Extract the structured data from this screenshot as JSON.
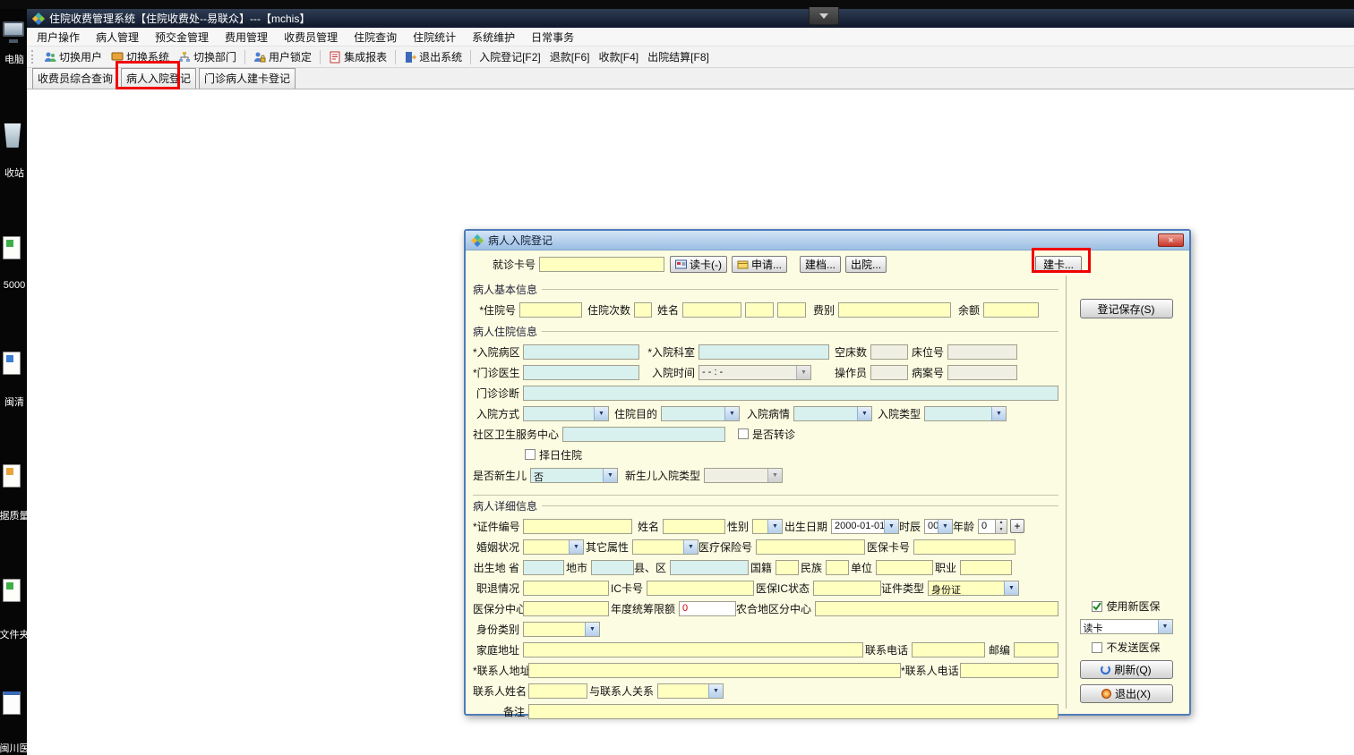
{
  "colors": {
    "annotation": "#f00000",
    "input_yellow": "#ffffc0",
    "input_cyan": "#d8f0ee",
    "dialog_bg": "#fcfce2"
  },
  "desktop": {
    "icons": [
      {
        "label": "电脑"
      },
      {
        "label": "收站"
      },
      {
        "label": "5000"
      },
      {
        "label": "闽清"
      },
      {
        "label": "据质量"
      },
      {
        "label": "文件夹"
      },
      {
        "label": "闽川医"
      }
    ]
  },
  "titlebar": {
    "title": "住院收费管理系统【住院收费处--易联众】---【mchis】"
  },
  "menubar": {
    "items": [
      "用户操作",
      "病人管理",
      "预交金管理",
      "费用管理",
      "收费员管理",
      "住院查询",
      "住院统计",
      "系统维护",
      "日常事务"
    ]
  },
  "toolbar": {
    "items": [
      "切换用户",
      "切换系统",
      "切换部门",
      "用户锁定",
      "集成报表",
      "退出系统",
      "入院登记[F2]",
      "退款[F6]",
      "收款[F4]",
      "出院结算[F8]"
    ]
  },
  "tabs": {
    "items": [
      "收费员综合查询",
      "病人入院登记",
      "门诊病人建卡登记"
    ]
  },
  "dialog": {
    "title": "病人入院登记",
    "close_glyph": "×",
    "card_row": {
      "label": "就诊卡号",
      "read_card": "读卡(-)",
      "apply": "申请...",
      "create_file": "建档...",
      "discharge": "出院...",
      "create_card": "建卡..."
    },
    "basic": {
      "legend": "病人基本信息",
      "inpatient_no": "*住院号",
      "admit_count": "住院次数",
      "name": "姓名",
      "fee_type": "费别",
      "balance": "余额"
    },
    "admission": {
      "legend": "病人住院信息",
      "ward": "*入院病区",
      "dept": "*入院科室",
      "empty_beds": "空床数",
      "bed_no": "床位号",
      "doctor": "*门诊医生",
      "admit_time": "入院时间",
      "admit_time_value": "- -   :   -",
      "operator": "操作员",
      "record_no": "病案号",
      "diagnosis": "门诊诊断",
      "admit_way": "入院方式",
      "purpose": "住院目的",
      "condition": "入院病情",
      "admit_type": "入院类型",
      "community": "社区卫生服务中心",
      "is_referral": "是否转诊",
      "scheduled": "择日住院",
      "is_newborn": "是否新生儿",
      "is_newborn_value": "否",
      "newborn_type": "新生儿入院类型"
    },
    "detail": {
      "legend": "病人详细信息",
      "cert_no": "*证件编号",
      "name": "姓名",
      "gender": "性别",
      "birth_date": "出生日期",
      "birth_date_value": "2000-01-01",
      "hour": "时辰",
      "hour_value": "00",
      "age": "年龄",
      "age_value": "0",
      "plus": "+",
      "marital": "婚姻状况",
      "other_attr": "其它属性",
      "medical_no": "医疗保险号",
      "insurance_card": "医保卡号",
      "birthplace": "出生地 省",
      "city": "地市",
      "county": "县、区",
      "nationality": "国籍",
      "ethnicity": "民族",
      "employer": "单位",
      "occupation": "职业",
      "job_status": "职退情况",
      "ic_card": "IC卡号",
      "ins_ic_status": "医保IC状态",
      "cert_type": "证件类型",
      "cert_type_value": "身份证",
      "ins_branch": "医保分中心",
      "quota": "年度统筹限额",
      "quota_value": "0",
      "rural_branch": "农合地区分中心",
      "identity": "身份类别",
      "home_address": "家庭地址",
      "phone": "联系电话",
      "zip": "邮编",
      "contact_address": "*联系人地址",
      "contact_phone": "*联系人电话",
      "contact_name": "联系人姓名",
      "relation": "与联系人关系",
      "remark": "备注"
    },
    "side": {
      "save": "登记保存(S)",
      "use_new_insurance": "使用新医保",
      "read_mode": "读卡",
      "no_send": "不发送医保",
      "refresh": "刷新(Q)",
      "exit": "退出(X)"
    }
  }
}
